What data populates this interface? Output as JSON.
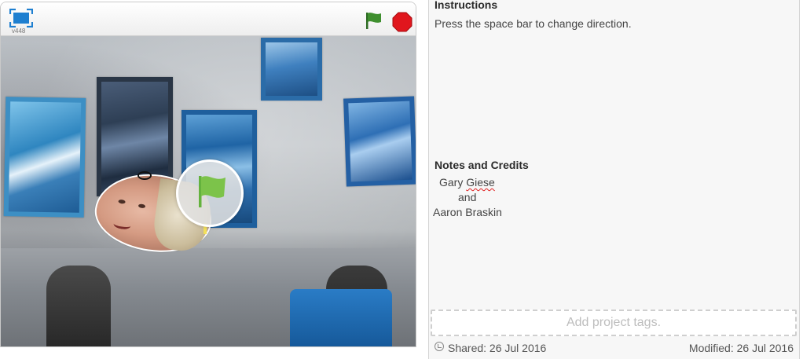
{
  "player": {
    "version": "v448",
    "icons": {
      "fullscreen": "fullscreen-icon",
      "flag": "green-flag-icon",
      "stop": "stop-sign-icon"
    },
    "colors": {
      "flag": "#3f8f2f",
      "stop": "#e0161d",
      "fullscreen": "#1e7fd0"
    }
  },
  "info": {
    "instructions_heading": "Instructions",
    "instructions_text": "Press the space bar to change direction.",
    "notes_heading": "Notes and Credits",
    "credits": {
      "line1_prefix": "Gary ",
      "line1_name": "Giese",
      "line2": "and",
      "line3": "Aaron Braskin"
    },
    "tags_placeholder": "Add project tags.",
    "shared": "Shared: 26 Jul 2016",
    "modified": "Modified: 26 Jul 2016"
  }
}
